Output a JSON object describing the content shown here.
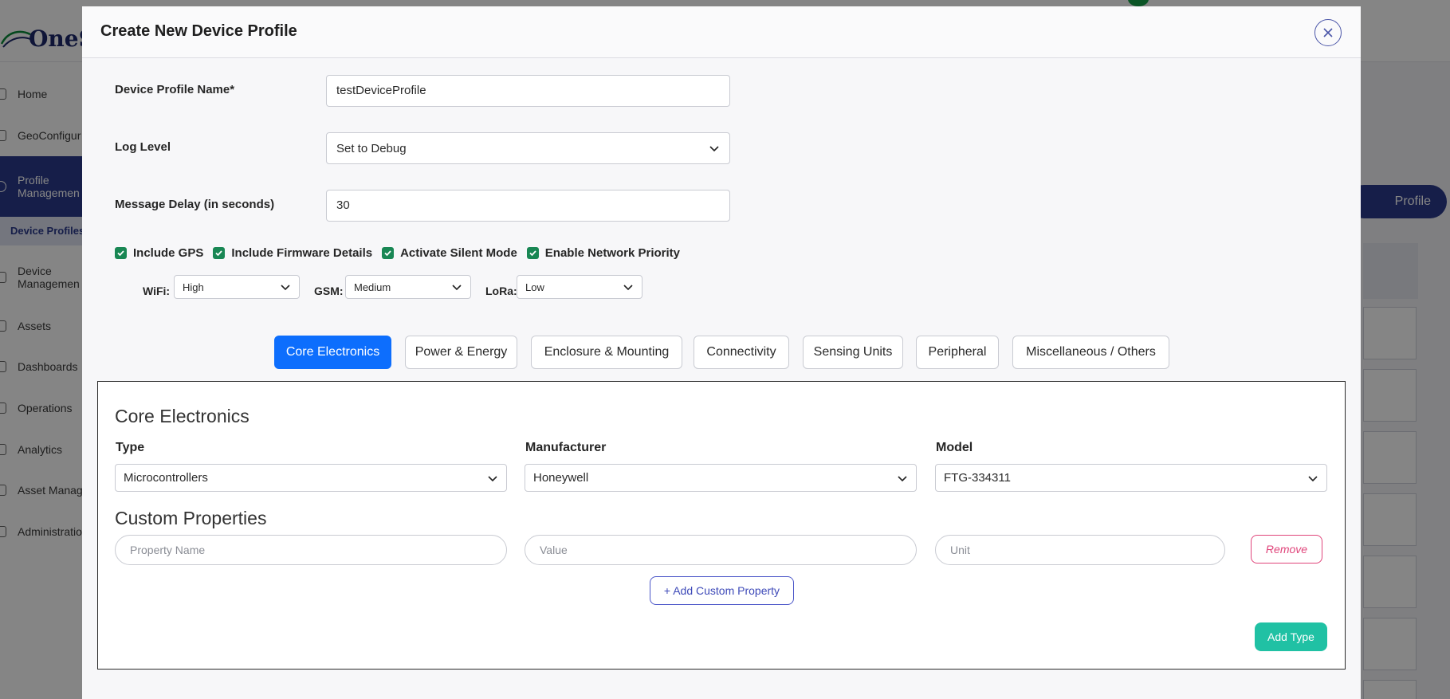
{
  "background": {
    "logo_text": "OneS",
    "nav": [
      {
        "label": "Home"
      },
      {
        "label": "GeoConfigur"
      },
      {
        "label": "Profile\nManagemen"
      },
      {
        "label": "Device\nManagemen"
      },
      {
        "label": "Assets"
      },
      {
        "label": "Dashboards"
      },
      {
        "label": "Operations"
      },
      {
        "label": "Analytics"
      },
      {
        "label": "Asset Manag"
      },
      {
        "label": "Administratio"
      }
    ],
    "nav_sub_active": "Device Profiles",
    "right_button_label": "Profile"
  },
  "modal": {
    "title": "Create New Device Profile",
    "fields": {
      "name_label": "Device Profile Name*",
      "name_value": "testDeviceProfile",
      "log_label": "Log Level",
      "log_value": "Set to Debug",
      "delay_label": "Message Delay (in seconds)",
      "delay_value": "30"
    },
    "checkboxes": [
      {
        "label": "Include GPS",
        "checked": true
      },
      {
        "label": "Include Firmware Details",
        "checked": true
      },
      {
        "label": "Activate Silent Mode",
        "checked": true
      },
      {
        "label": "Enable Network Priority",
        "checked": true
      }
    ],
    "priority": {
      "wifi_label": "WiFi:",
      "wifi_value": "High",
      "gsm_label": "GSM:",
      "gsm_value": "Medium",
      "lora_label": "LoRa:",
      "lora_value": "Low"
    },
    "tabs": [
      {
        "label": "Core Electronics",
        "active": true
      },
      {
        "label": "Power & Energy"
      },
      {
        "label": "Enclosure & Mounting"
      },
      {
        "label": "Connectivity"
      },
      {
        "label": "Sensing Units"
      },
      {
        "label": "Peripheral"
      },
      {
        "label": "Miscellaneous / Others"
      }
    ],
    "panel": {
      "title": "Core Electronics",
      "type_label": "Type",
      "type_value": "Microcontrollers",
      "manufacturer_label": "Manufacturer",
      "manufacturer_value": "Honeywell",
      "model_label": "Model",
      "model_value": "FTG-334311",
      "custom_title": "Custom Properties",
      "property_name_placeholder": "Property Name",
      "value_placeholder": "Value",
      "unit_placeholder": "Unit",
      "remove_label": "Remove",
      "add_custom_label": "+ Add Custom Property",
      "add_type_label": "Add Type"
    }
  },
  "colors": {
    "primary": "#0d6efd",
    "checkbox": "#198754",
    "remove": "#e0457b",
    "add_type": "#20c1a4",
    "brand": "#2b3a8c"
  }
}
